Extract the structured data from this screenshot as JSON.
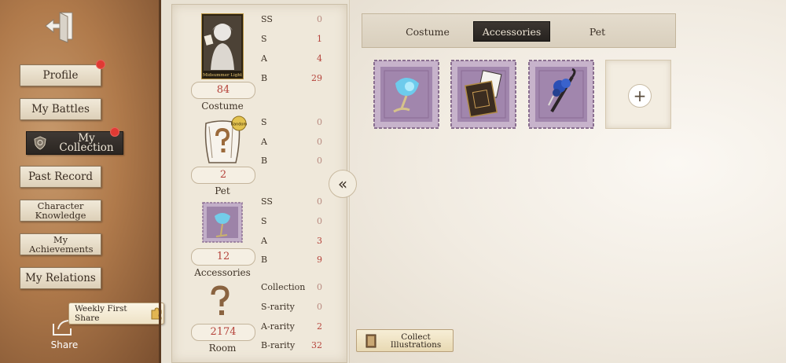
{
  "sidebar": {
    "items": [
      {
        "label": "Profile"
      },
      {
        "label": "My Battles"
      },
      {
        "label": "My Collection"
      },
      {
        "label": "Past Record"
      },
      {
        "label": "Character Knowledge"
      },
      {
        "label": "My Achievements"
      },
      {
        "label": "My Relations"
      }
    ],
    "share_tag": "Weekly First Share",
    "share_label": "Share"
  },
  "stats": {
    "costume": {
      "count": "84",
      "label": "Costume",
      "thumb_text": "Midsummer Light",
      "rarities": [
        {
          "label": "SS",
          "value": "0"
        },
        {
          "label": "S",
          "value": "1"
        },
        {
          "label": "A",
          "value": "4"
        },
        {
          "label": "B",
          "value": "29"
        }
      ]
    },
    "pet": {
      "count": "2",
      "label": "Pet",
      "thumb_text": "Random",
      "rarities": [
        {
          "label": "S",
          "value": "0"
        },
        {
          "label": "A",
          "value": "0"
        },
        {
          "label": "B",
          "value": "0"
        }
      ]
    },
    "accessories": {
      "count": "12",
      "label": "Accessories",
      "rarities": [
        {
          "label": "SS",
          "value": "0"
        },
        {
          "label": "S",
          "value": "0"
        },
        {
          "label": "A",
          "value": "3"
        },
        {
          "label": "B",
          "value": "9"
        }
      ]
    },
    "room": {
      "count": "2174",
      "label": "Room",
      "rarities": [
        {
          "label": "Collection",
          "value": "0"
        },
        {
          "label": "S-rarity",
          "value": "0"
        },
        {
          "label": "A-rarity",
          "value": "2"
        },
        {
          "label": "B-rarity",
          "value": "32"
        }
      ]
    }
  },
  "tabs": [
    {
      "label": "Costume"
    },
    {
      "label": "Accessories"
    },
    {
      "label": "Pet"
    }
  ],
  "active_tab": "Accessories",
  "accessory_slots": [
    {
      "icon": "glass-goblet-accessory-icon"
    },
    {
      "icon": "card-box-accessory-icon"
    },
    {
      "icon": "rose-umbrella-accessory-icon"
    }
  ],
  "add_slot_icon": "plus-icon",
  "collapse_icon": "double-chevron-left-icon",
  "collect_button": {
    "line1": "Collect",
    "line2": "Illustrations"
  },
  "colors": {
    "accent_red": "#b5433b",
    "active_dark": "#2a2521",
    "notification": "#e03a33"
  }
}
